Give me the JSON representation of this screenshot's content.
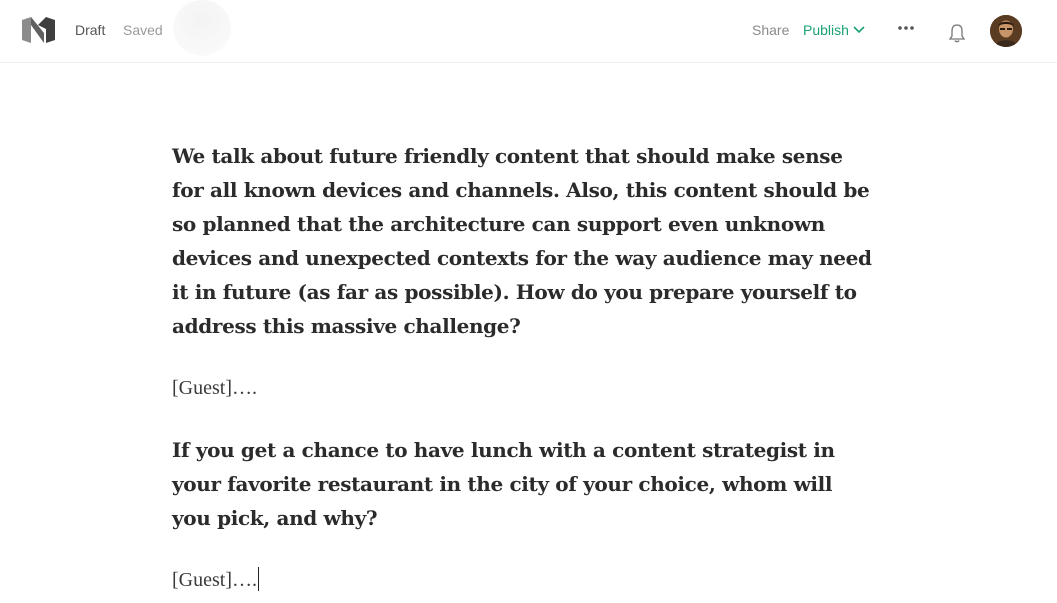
{
  "topbar": {
    "status_draft": "Draft",
    "status_saved": "Saved",
    "share_label": "Share",
    "publish_label": "Publish",
    "icons": {
      "logo": "medium-logo-icon",
      "publish_dropdown": "chevron-down-icon",
      "more": "more-dots-icon",
      "notifications": "bell-icon",
      "avatar": "user-avatar"
    },
    "colors": {
      "publish": "#1aa271",
      "muted": "#9a9a9a"
    }
  },
  "editor": {
    "question_1": "We talk about future friendly content that should make sense for all known devices and channels. Also, this content should be so planned that the architecture can support even unknown devices and unexpected contexts for the way audience may need it in future (as far as possible). How do you prepare yourself to address this massive challenge?",
    "answer_1": "[Guest]….",
    "question_2": "If you get a chance to have lunch with a content strategist in your favorite restaurant in the city of your choice, whom will you pick, and why?",
    "answer_2": "[Guest]…."
  }
}
